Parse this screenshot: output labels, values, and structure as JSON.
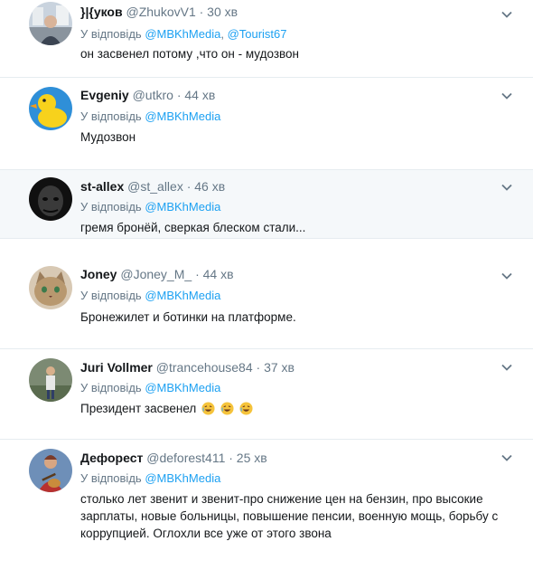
{
  "reply_prefix": "У відповідь",
  "tweets": [
    {
      "name": "}|{уков",
      "handle": "@ZhukovV1",
      "time": "· 30 хв",
      "reply_to": [
        "@MBKhMedia",
        "@Tourist67"
      ],
      "text": "он засвенел потому ,что он - мудозвон",
      "avatar_icon": "person-photo-icon"
    },
    {
      "name": "Evgeniy",
      "handle": "@utkro",
      "time": "· 44 хв",
      "reply_to": [
        "@MBKhMedia"
      ],
      "text": "Мудозвон",
      "avatar_icon": "duck-avatar-icon"
    },
    {
      "name": "st-allex",
      "handle": "@st_allex",
      "time": "· 46 хв",
      "reply_to": [
        "@MBKhMedia"
      ],
      "text": "гремя бронёй, сверкая блеском стали...",
      "avatar_icon": "dark-face-avatar-icon"
    },
    {
      "name": "Joney",
      "handle": "@Joney_M_",
      "time": "· 44 хв",
      "reply_to": [
        "@MBKhMedia"
      ],
      "text": "Бронежилет и ботинки на платформе.",
      "avatar_icon": "cat-avatar-icon"
    },
    {
      "name": "Juri Vollmer",
      "handle": "@trancehouse84",
      "time": "· 37 хв",
      "reply_to": [
        "@MBKhMedia"
      ],
      "text": "Президент засвенел",
      "emoji_count": 3,
      "avatar_icon": "person-standing-avatar-icon"
    },
    {
      "name": "Дефорест",
      "handle": "@deforest411",
      "time": "· 25 хв",
      "reply_to": [
        "@MBKhMedia"
      ],
      "text_lines": [
        "столько лет звенит и звенит-про снижение цен на бензин, про высокие",
        "зарплаты, новые больницы, повышение пенсии, военную мощь, борьбу с",
        "коррупцией. Оглохли все уже от этого звона"
      ],
      "avatar_icon": "guitar-player-avatar-icon"
    }
  ],
  "colors": {
    "mention": "#1da1f2",
    "muted": "#657786",
    "highlight": "#f5f8fa",
    "divider": "#e6ecf0"
  }
}
